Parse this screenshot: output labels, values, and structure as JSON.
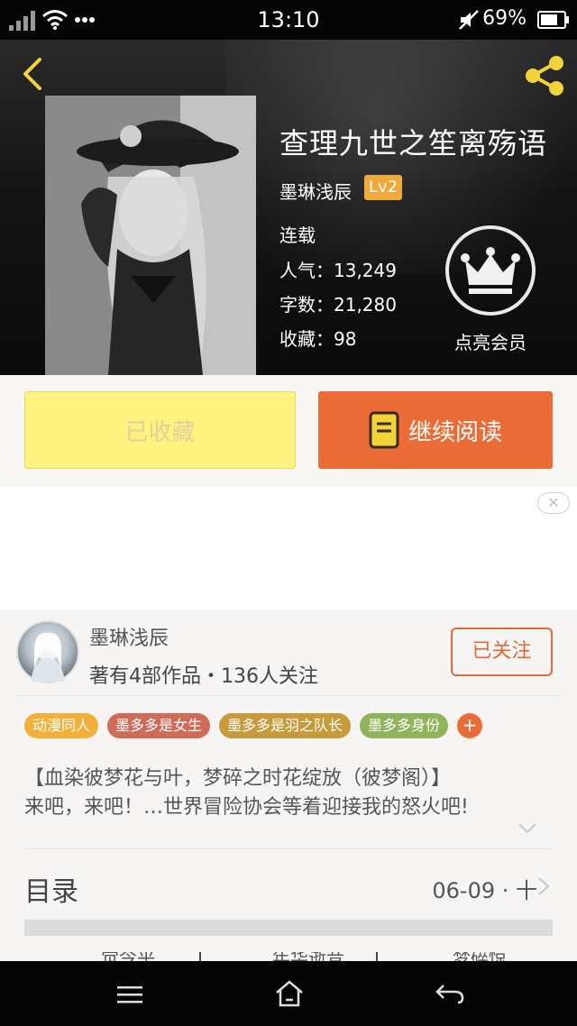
{
  "status_bar": {
    "time": "13:10",
    "battery_percent": "69%"
  },
  "book": {
    "title": "查理九世之笙离殇语",
    "author": "墨琳浅辰",
    "author_level": "Lv2",
    "status": "连载",
    "popularity": "人气：13,249",
    "word_count": "字数：21,280",
    "favorites": "收藏：98",
    "vip_label": "点亮会员"
  },
  "actions": {
    "favorite_label": "已收藏",
    "read_label": "继续阅读"
  },
  "ad": {
    "close_symbol": "✕"
  },
  "author_card": {
    "name": "墨琳浅辰",
    "meta": "著有4部作品・136人关注",
    "follow_label": "已关注"
  },
  "tags": [
    {
      "label": "动漫同人",
      "color": "#f2b03a"
    },
    {
      "label": "墨多多是女生",
      "color": "#d06b58"
    },
    {
      "label": "墨多多是羽之队长",
      "color": "#c79a3c"
    },
    {
      "label": "墨多多身份",
      "color": "#8fb45a"
    }
  ],
  "tag_add_symbol": "+",
  "description": {
    "line1": "【血染彼梦花与叶，梦碎之时花绽放（彼梦阁）】",
    "line2": "来吧，来吧！…世界冒险协会等着迎接我的怒火吧!"
  },
  "toc": {
    "label": "目录",
    "date": "06-09 · 十"
  },
  "chapters": [
    "觉今乎",
    "年华逝昔",
    "梦碎惊"
  ],
  "colors": {
    "accent": "#ec6c37",
    "favorite_bg": "#fff27f",
    "icon_yellow": "#f3d33a"
  }
}
